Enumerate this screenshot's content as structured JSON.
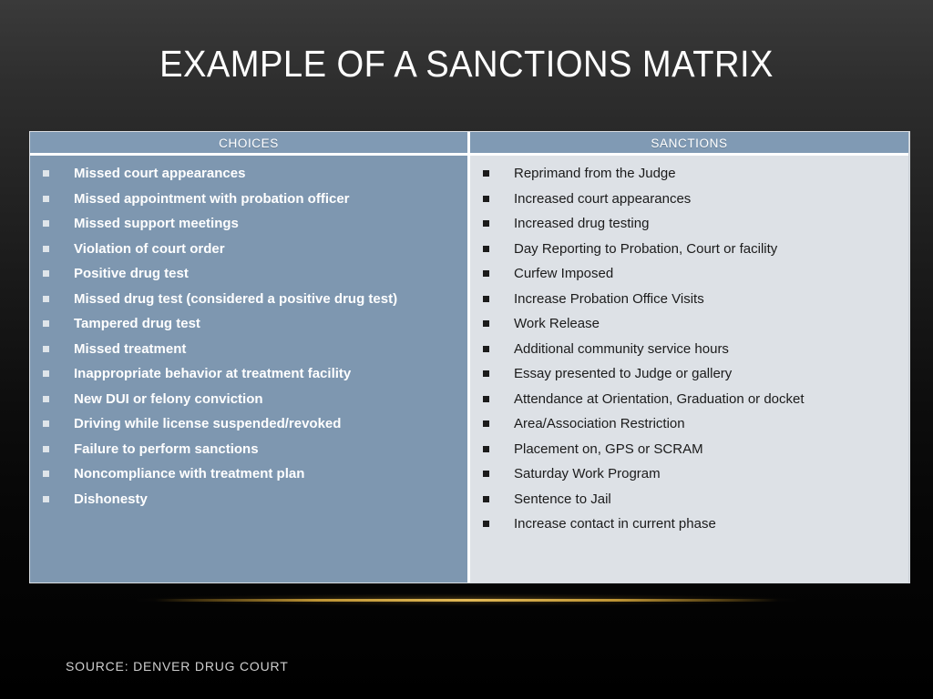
{
  "slide": {
    "title": "EXAMPLE OF A SANCTIONS MATRIX",
    "source": "SOURCE: DENVER DRUG COURT"
  },
  "colors": {
    "background_top": "#3a3a3a",
    "background_bottom": "#000000",
    "header_fill": "#809ab4",
    "choices_fill": "#7e97b0",
    "sanctions_fill": "#dde1e6",
    "title_text": "#ffffff",
    "choices_text": "#ffffff",
    "sanctions_text": "#1b1b1b",
    "accent_rule": "#e2b956",
    "source_text": "#cfcfcf"
  },
  "matrix": {
    "choices": {
      "header": "CHOICES",
      "items": [
        "Missed court appearances",
        "Missed appointment with probation officer",
        "Missed support meetings",
        "Violation of court order",
        "Positive drug test",
        "Missed drug test (considered a positive drug test)",
        "Tampered drug test",
        "Missed treatment",
        "Inappropriate behavior at treatment facility",
        "New DUI or felony conviction",
        "Driving while license suspended/revoked",
        "Failure to perform sanctions",
        "Noncompliance with treatment plan",
        "Dishonesty"
      ]
    },
    "sanctions": {
      "header": "SANCTIONS",
      "items": [
        "Reprimand from the Judge",
        "Increased court appearances",
        "Increased drug testing",
        "Day Reporting to Probation, Court or facility",
        "Curfew Imposed",
        "Increase Probation Office Visits",
        "Work Release",
        "Additional community service hours",
        "Essay presented to Judge or gallery",
        "Attendance at Orientation, Graduation or docket",
        "Area/Association Restriction",
        "Placement on, GPS or SCRAM",
        "Saturday Work Program",
        "Sentence to Jail",
        "Increase contact in current phase"
      ]
    }
  }
}
